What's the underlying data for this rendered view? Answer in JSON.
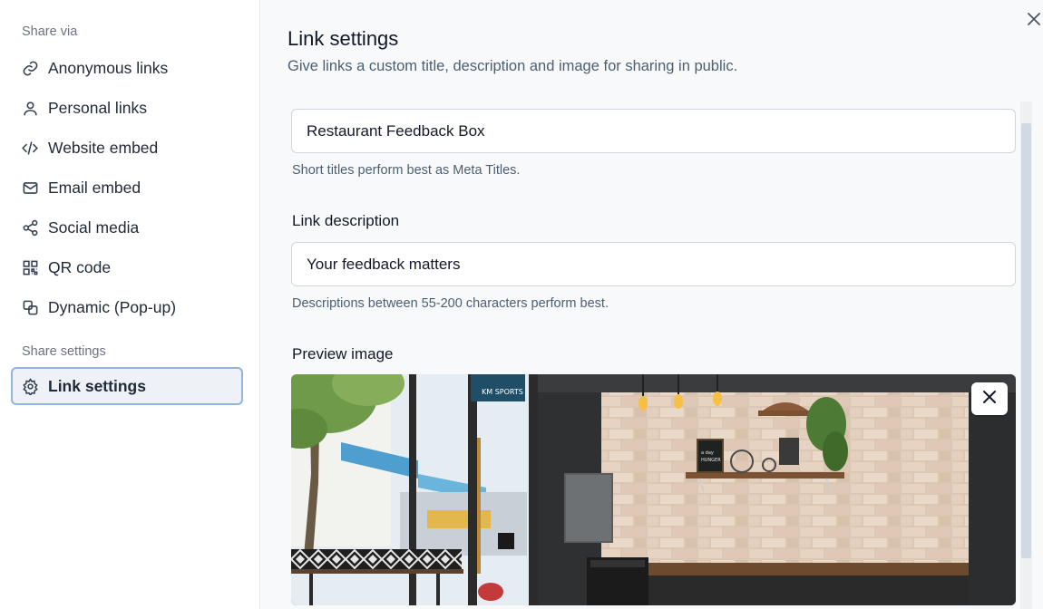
{
  "sidebar": {
    "share_via_label": "Share via",
    "share_settings_label": "Share settings",
    "items": [
      {
        "label": "Anonymous links",
        "icon": "link-icon"
      },
      {
        "label": "Personal links",
        "icon": "user-icon"
      },
      {
        "label": "Website embed",
        "icon": "code-icon"
      },
      {
        "label": "Email embed",
        "icon": "mail-icon"
      },
      {
        "label": "Social media",
        "icon": "share-icon"
      },
      {
        "label": "QR code",
        "icon": "qr-code-icon"
      },
      {
        "label": "Dynamic (Pop-up)",
        "icon": "popup-icon"
      }
    ],
    "settings_items": [
      {
        "label": "Link settings",
        "icon": "gear-icon",
        "active": true
      }
    ]
  },
  "main": {
    "title": "Link settings",
    "subtitle": "Give links a custom title, description and image for sharing in public.",
    "title_field": {
      "value": "Restaurant Feedback Box",
      "help": "Short titles perform best as Meta Titles."
    },
    "description_field": {
      "label": "Link description",
      "value": "Your feedback matters",
      "help": "Descriptions between 55-200 characters perform best."
    },
    "preview_image": {
      "label": "Preview image",
      "alt_icon": "close-icon"
    }
  },
  "colors": {
    "active_border": "#93b4dd",
    "active_bg": "#eef2f7",
    "help_text": "#4b5f73"
  }
}
